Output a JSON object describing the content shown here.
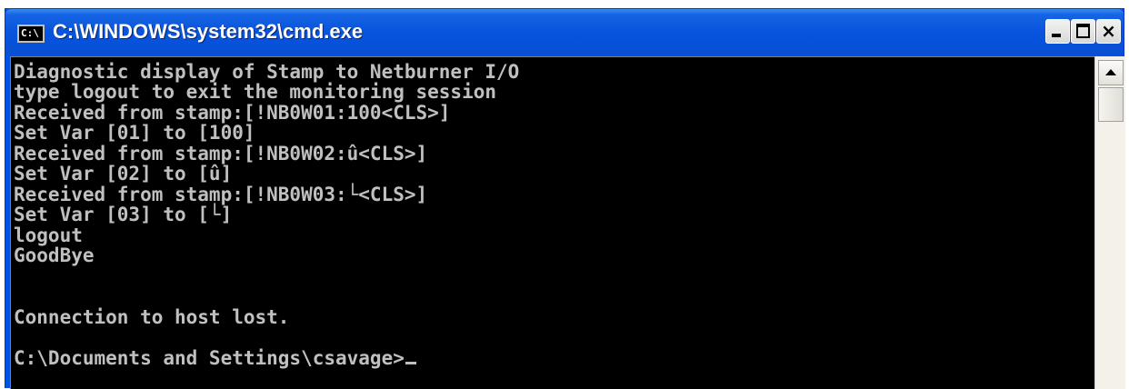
{
  "window": {
    "title": "C:\\WINDOWS\\system32\\cmd.exe",
    "icon": "cmd-icon",
    "icon_text": "C:\\"
  },
  "titlebar_buttons": {
    "minimize": "minimize-icon",
    "maximize": "maximize-icon",
    "close_label": "×"
  },
  "console": {
    "lines": [
      "Diagnostic display of Stamp to Netburner I/O",
      "type logout to exit the monitoring session",
      "Received from stamp:[!NB0W01:100<CLS>]",
      "Set Var [01] to [100]",
      "Received from stamp:[!NB0W02:û<CLS>]",
      "Set Var [02] to [û]",
      "Received from stamp:[!NB0W03:└<CLS>]",
      "Set Var [03] to [└]",
      "logout",
      "GoodBye",
      "",
      "",
      "Connection to host lost.",
      "",
      "C:\\Documents and Settings\\csavage>"
    ]
  },
  "colors": {
    "titlebar": "#0a55dd",
    "console_bg": "#000000",
    "console_text": "#c0c0c0"
  }
}
